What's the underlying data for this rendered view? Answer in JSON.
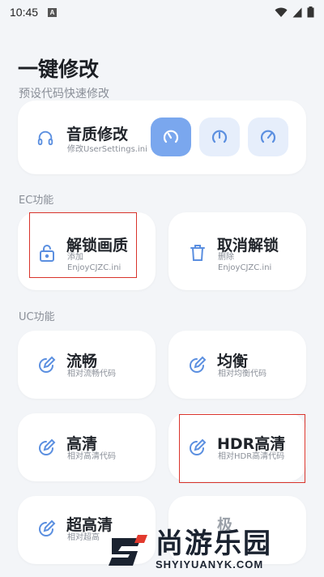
{
  "status_bar": {
    "time": "10:45",
    "notif_letter": "A"
  },
  "header": {
    "title": "一键修改",
    "subtitle": "预设代码快速修改"
  },
  "quality_card": {
    "title": "音质修改",
    "subtitle": "修改UserSettings.ini",
    "modes": [
      {
        "icon": "speedometer-low-icon",
        "selected": true
      },
      {
        "icon": "speedometer-mid-icon",
        "selected": false
      },
      {
        "icon": "speedometer-high-icon",
        "selected": false
      }
    ]
  },
  "ec_section": {
    "label": "EC功能",
    "cards": [
      {
        "title": "解锁画质",
        "sub1": "添加",
        "sub2": "EnjoyCJZC.ini",
        "icon": "lock-icon"
      },
      {
        "title": "取消解锁",
        "sub1": "删除",
        "sub2": "EnjoyCJZC.ini",
        "icon": "trash-icon"
      }
    ]
  },
  "uc_section": {
    "label": "UC功能",
    "cards": [
      {
        "title": "流畅",
        "sub": "相对流畅代码",
        "icon": "edit-icon"
      },
      {
        "title": "均衡",
        "sub": "相对均衡代码",
        "icon": "edit-icon"
      },
      {
        "title": "高清",
        "sub": "相对高清代码",
        "icon": "edit-icon"
      },
      {
        "title": "HDR高清",
        "sub": "相对HDR高清代码",
        "icon": "edit-icon"
      },
      {
        "title": "超高清",
        "sub": "相对超高",
        "icon": "edit-icon"
      },
      {
        "title": "极",
        "sub": "",
        "icon": "edit-icon"
      }
    ]
  },
  "watermark": {
    "cn": "尚游乐园",
    "en": "SHYIYUANYK.COM"
  },
  "colors": {
    "accent": "#7aa7ee",
    "accent_light": "#e6eefb",
    "icon_blue": "#5b8fe0",
    "highlight_red": "#d9332b"
  }
}
